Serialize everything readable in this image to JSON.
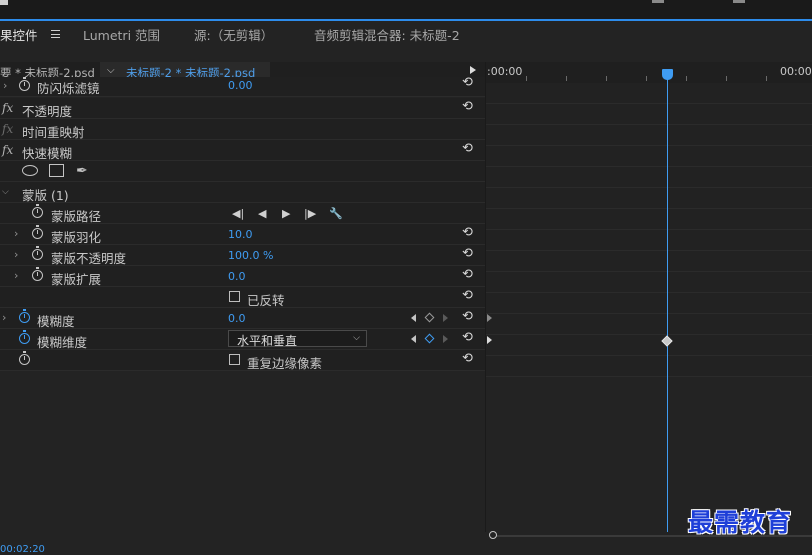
{
  "tabs": [
    {
      "label": "果控件",
      "active": true
    },
    {
      "label": "Lumetri 范围",
      "active": false
    },
    {
      "label": "源:（无剪辑）",
      "active": false
    },
    {
      "label": "音频剪辑混合器: 未标题-2",
      "active": false
    }
  ],
  "sequence": {
    "source_label": "要 * 未标题-2.psd",
    "active_label": "未标题-2 * 未标题-2.psd"
  },
  "timeline": {
    "time_start": ":00:00",
    "time_end": "00:00"
  },
  "rows": {
    "anti_flicker": {
      "label": "防闪烁滤镜",
      "value": "0.00"
    },
    "opacity": {
      "fx": "fx",
      "label": "不透明度"
    },
    "time_remap": {
      "fx": "fx",
      "label": "时间重映射"
    },
    "fast_blur": {
      "fx": "fx",
      "label": "快速模糊"
    },
    "mask": {
      "label": "蒙版 (1)"
    },
    "mask_path": {
      "label": "蒙版路径"
    },
    "mask_feather": {
      "label": "蒙版羽化",
      "value": "10.0"
    },
    "mask_opacity": {
      "label": "蒙版不透明度",
      "value": "100.0 %"
    },
    "mask_expansion": {
      "label": "蒙版扩展",
      "value": "0.0"
    },
    "inverted": {
      "label": "已反转",
      "checked": false
    },
    "blurriness": {
      "label": "模糊度",
      "value": "0.0"
    },
    "blur_dimensions": {
      "label": "模糊维度",
      "value": "水平和垂直"
    },
    "repeat_edge": {
      "label": "重复边缘像素",
      "checked": false
    }
  },
  "footer": {
    "timecode": "00:02:20"
  },
  "watermark": "最需教育",
  "colors": {
    "accent": "#3f9cf2",
    "background": "#232323",
    "watermark": "#1e3fd8"
  }
}
